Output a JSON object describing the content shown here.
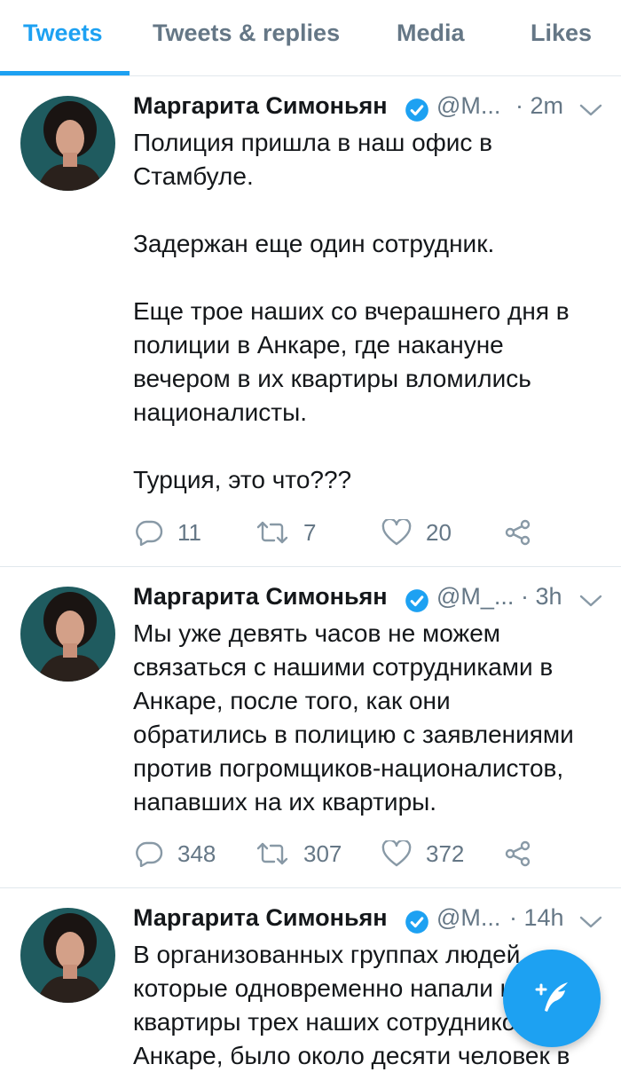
{
  "tabs": [
    {
      "label": "Tweets",
      "active": true
    },
    {
      "label": "Tweets & replies",
      "active": false
    },
    {
      "label": "Media",
      "active": false
    },
    {
      "label": "Likes",
      "active": false
    }
  ],
  "colors": {
    "accent": "#1da1f2",
    "secondary_text": "#657786",
    "divider": "#e1e8ed",
    "text": "#14171a"
  },
  "tweets": [
    {
      "author": "Маргарита Симоньян",
      "handle": "@M...",
      "time": "· 2m",
      "lines": [
        "Полиция пришла в наш офис в",
        "Стамбуле.",
        "",
        "Задержан еще один сотрудник.",
        "",
        "Еще трое наших со вчерашнего дня в",
        "полиции в Анкаре, где накануне",
        "вечером в их квартиры вломились",
        "националисты.",
        "",
        "Турция, это что???"
      ],
      "replies": "11",
      "retweets": "7",
      "likes": "20"
    },
    {
      "author": "Маргарита Симоньян",
      "handle": "@M_...",
      "time": "· 3h",
      "lines": [
        "Мы уже девять часов не можем",
        "связаться с нашими сотрудниками в",
        "Анкаре, после того, как они",
        "обратились в полицию с заявлениями",
        "против погромщиков-националистов,",
        "напавших на их квартиры."
      ],
      "replies": "348",
      "retweets": "307",
      "likes": "372"
    },
    {
      "author": "Маргарита Симоньян",
      "handle": "@M...",
      "time": "· 14h",
      "lines": [
        "В организованных группах людей,",
        "которые одновременно напали на",
        "квартиры трех наших сотрудников в",
        "Анкаре, было около десяти человек в"
      ]
    }
  ],
  "icons": {
    "verified": "verified-badge-icon",
    "caret": "chevron-down-icon",
    "reply": "reply-icon",
    "retweet": "retweet-icon",
    "like": "heart-icon",
    "share": "share-icon",
    "compose": "compose-tweet-icon"
  }
}
